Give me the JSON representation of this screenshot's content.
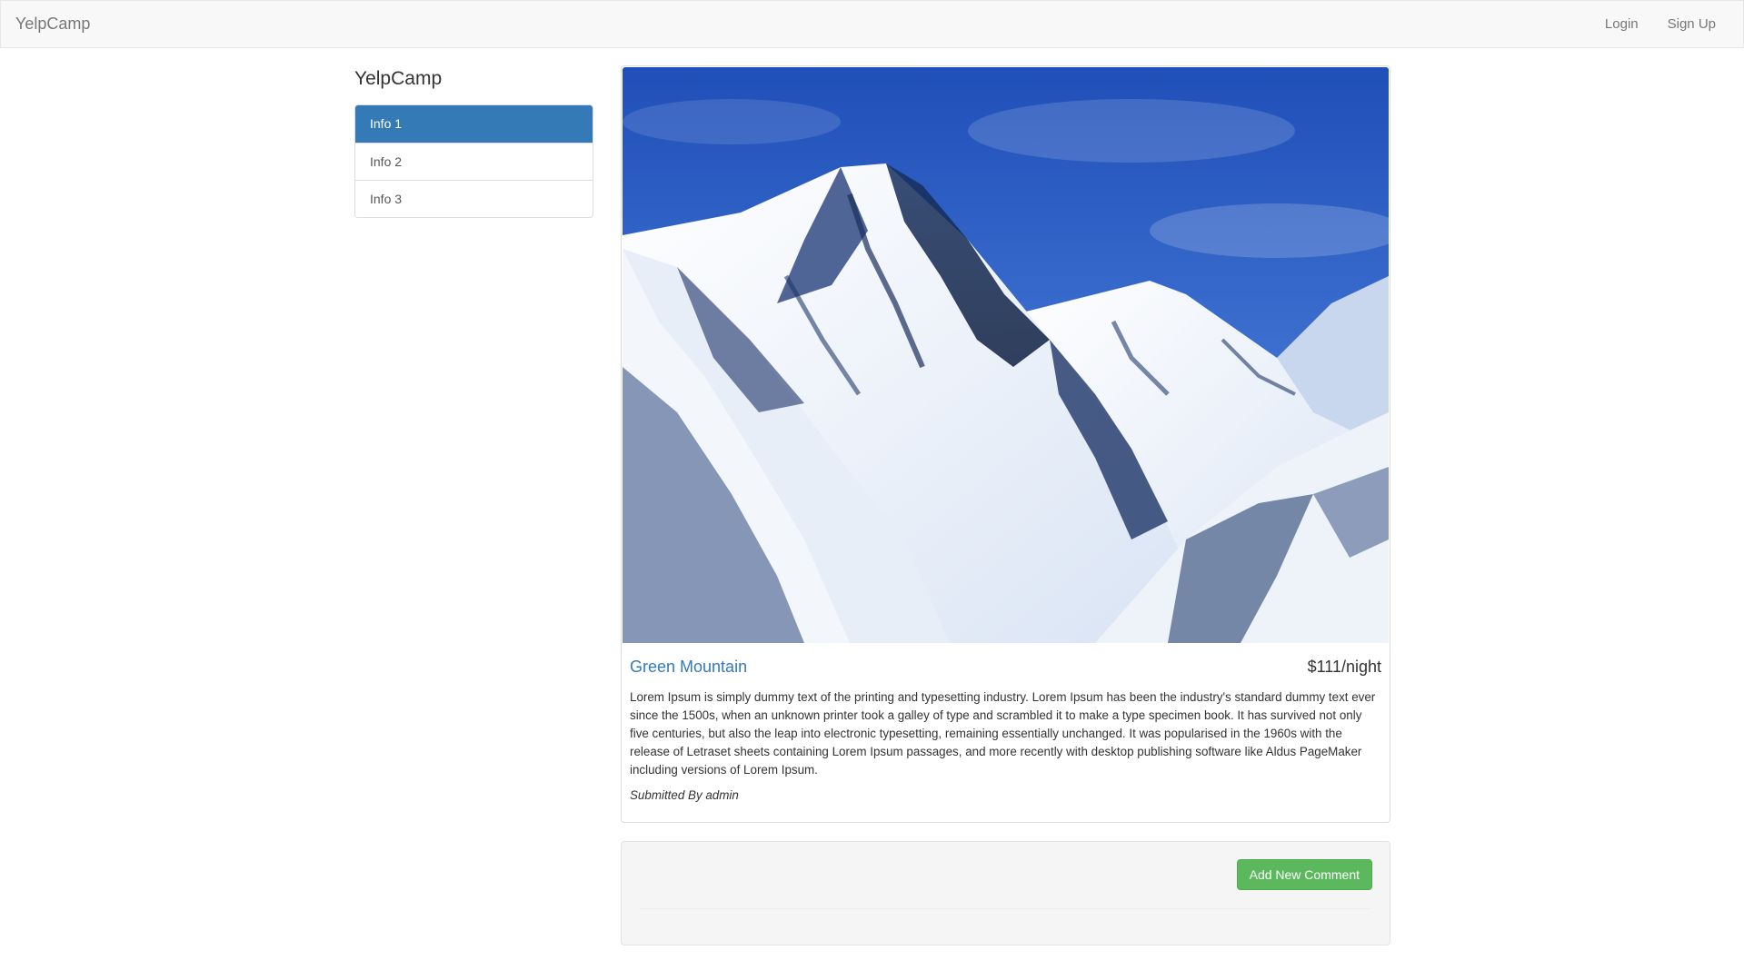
{
  "navbar": {
    "brand": "YelpCamp",
    "links": [
      "Login",
      "Sign Up"
    ]
  },
  "sidebar": {
    "title": "YelpCamp",
    "items": [
      {
        "label": "Info 1",
        "active": true
      },
      {
        "label": "Info 2",
        "active": false
      },
      {
        "label": "Info 3",
        "active": false
      }
    ]
  },
  "campground": {
    "name": "Green Mountain",
    "price": "$111/night",
    "description": "Lorem Ipsum is simply dummy text of the printing and typesetting industry. Lorem Ipsum has been the industry's standard dummy text ever since the 1500s, when an unknown printer took a galley of type and scrambled it to make a type specimen book. It has survived not only five centuries, but also the leap into electronic typesetting, remaining essentially unchanged. It was popularised in the 1960s with the release of Letraset sheets containing Lorem Ipsum passages, and more recently with desktop publishing software like Aldus PageMaker including versions of Lorem Ipsum.",
    "submitted_by": "Submitted By admin"
  },
  "comments": {
    "add_button": "Add New Comment"
  },
  "colors": {
    "primary": "#337ab7",
    "success": "#5cb85c",
    "navbar_bg": "#f8f8f8"
  }
}
